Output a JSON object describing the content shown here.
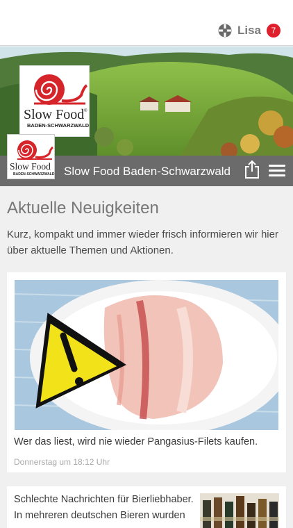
{
  "user": {
    "name": "Lisa",
    "notification_count": "7"
  },
  "logo": {
    "text": "Slow Food",
    "registered": "®",
    "subtitle": "BADEN-SCHWARZWALD"
  },
  "header": {
    "title": "Slow Food Baden-Schwarzwald"
  },
  "main": {
    "heading": "Aktuelle Neuigkeiten",
    "intro": "Kurz, kompakt und immer wieder frisch informieren wir hier über aktuelle Themen und Aktionen."
  },
  "articles": [
    {
      "title": "Wer das liest, wird nie wieder Pangasius-Filets kaufen.",
      "date": "Donnerstag um 18:12 Uhr"
    },
    {
      "title": "Schlechte Nachrichten für Bierliebhaber. In mehreren deutschen Bieren wurden"
    }
  ],
  "colors": {
    "accent_red": "#e01f2c",
    "titlebar": "#6b6b6b",
    "background": "#f0f0f0"
  },
  "icons": [
    "slowfood-user-icon",
    "share-icon",
    "hamburger-menu-icon",
    "warning-icon"
  ]
}
